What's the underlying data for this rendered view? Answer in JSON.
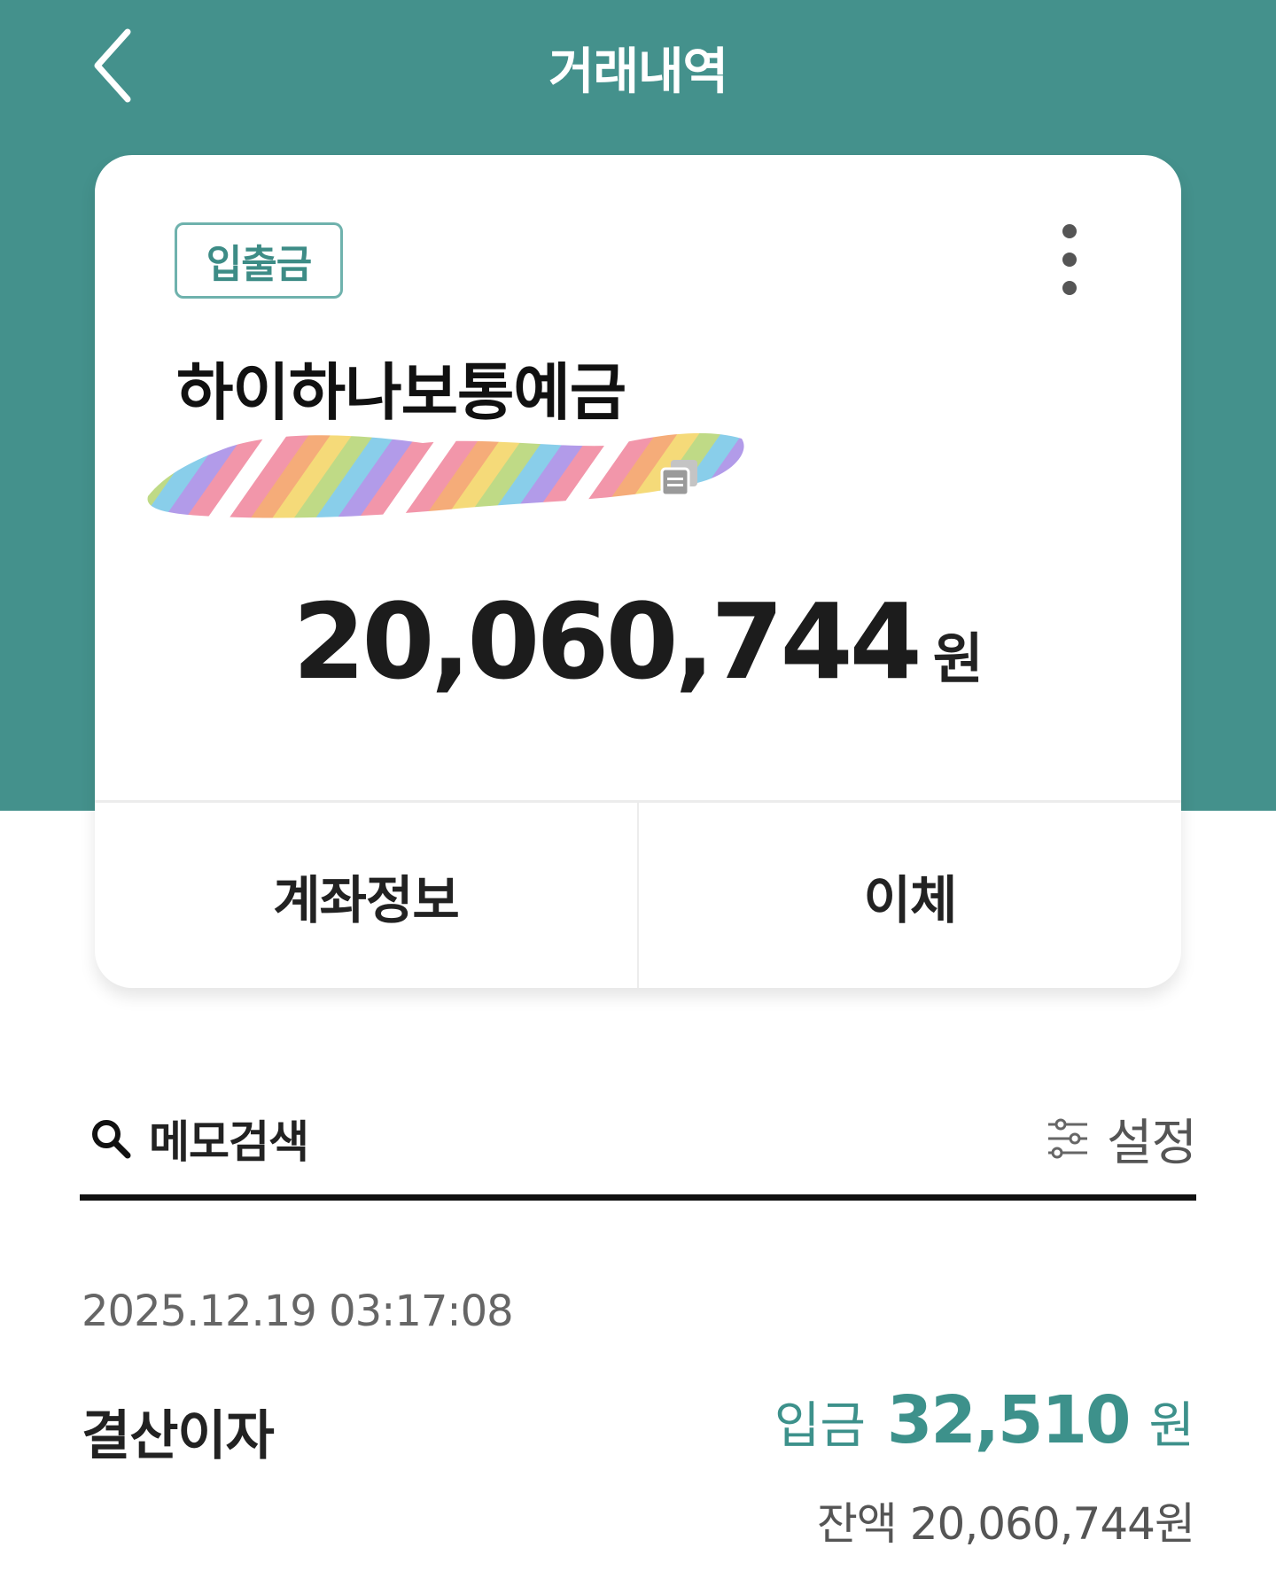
{
  "header": {
    "title": "거래내역",
    "back_icon": "chevron-left-icon"
  },
  "account_card": {
    "type_badge": "입출금",
    "name": "하이하나보통예금",
    "account_number_redacted": true,
    "balance": "20,060,744",
    "balance_unit": "원",
    "actions": {
      "account_info": "계좌정보",
      "transfer": "이체"
    }
  },
  "search": {
    "memo_search_label": "메모검색",
    "settings_label": "설정"
  },
  "transactions": [
    {
      "datetime": "2025.12.19 03:17:08",
      "description": "결산이자",
      "type": "입금",
      "amount": "32,510",
      "unit": "원",
      "balance_text": "잔액 20,060,744원"
    }
  ],
  "colors": {
    "brand_teal": "#44918c",
    "deposit_teal": "#3d918b",
    "text_dark": "#222222"
  }
}
